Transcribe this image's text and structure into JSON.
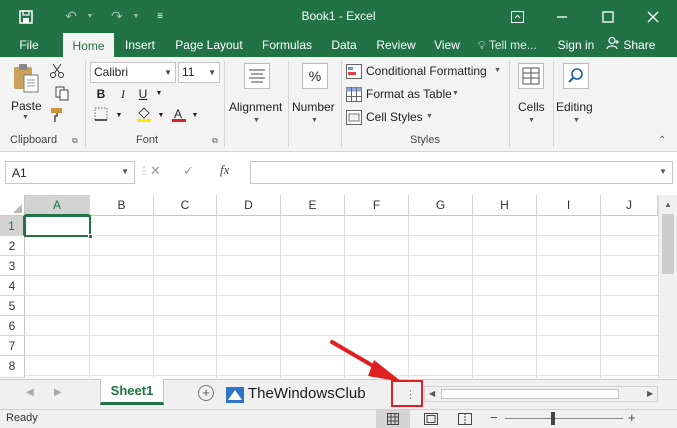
{
  "window": {
    "title": "Book1  -  Excel",
    "colors": {
      "brand": "#217346",
      "ribbon": "#f3f3f3",
      "annotation": "#e02020",
      "watermark_blue": "#2f74c9"
    }
  },
  "tabs": [
    {
      "label": "File",
      "active": false
    },
    {
      "label": "Home",
      "active": true
    },
    {
      "label": "Insert",
      "active": false
    },
    {
      "label": "Page Layout",
      "active": false
    },
    {
      "label": "Formulas",
      "active": false
    },
    {
      "label": "Data",
      "active": false
    },
    {
      "label": "Review",
      "active": false
    },
    {
      "label": "View",
      "active": false
    }
  ],
  "tellme": "Tell me...",
  "signin": "Sign in",
  "share": "Share",
  "ribbon": {
    "clipboard": {
      "paste": "Paste",
      "label": "Clipboard"
    },
    "font": {
      "family": "Calibri",
      "size": "11",
      "label": "Font",
      "bold": "B",
      "italic": "I",
      "underline": "U"
    },
    "alignment": {
      "label": "Alignment"
    },
    "number": {
      "label": "Number",
      "symbol": "%"
    },
    "styles": {
      "conditional": "Conditional Formatting",
      "table": "Format as Table",
      "cell_styles": "Cell Styles",
      "label": "Styles"
    },
    "cells": {
      "label": "Cells"
    },
    "editing": {
      "label": "Editing"
    }
  },
  "formula_bar": {
    "name_box": "A1",
    "fx": "fx",
    "value": ""
  },
  "grid": {
    "columns": [
      "A",
      "B",
      "C",
      "D",
      "E",
      "F",
      "G",
      "H",
      "I",
      "J"
    ],
    "rows": [
      "1",
      "2",
      "3",
      "4",
      "5",
      "6",
      "7",
      "8"
    ],
    "selected_cell": "A1"
  },
  "sheets": [
    {
      "name": "Sheet1",
      "active": true
    }
  ],
  "watermark": "TheWindowsClub",
  "status": {
    "ready": "Ready",
    "zoom_minus": "−",
    "zoom_plus": "+"
  }
}
